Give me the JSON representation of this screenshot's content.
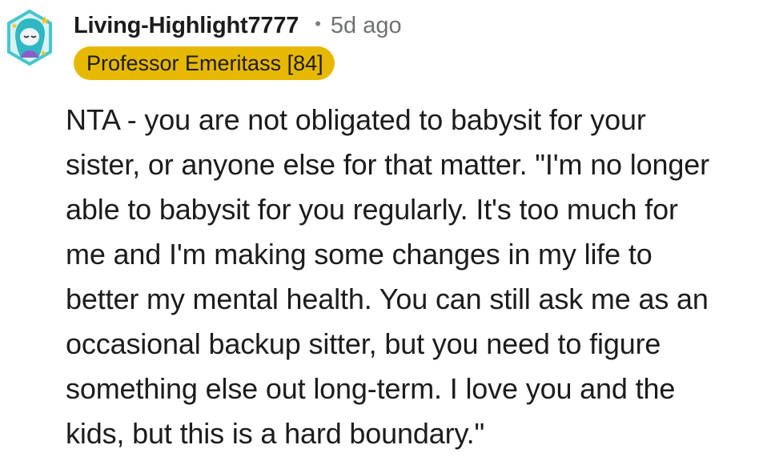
{
  "comment": {
    "username": "Living-Highlight7777",
    "separator": "•",
    "age": "5d ago",
    "flair": "Professor Emeritass [84]",
    "flair_color": "#e6b800",
    "avatar_icon": "snoo-avatar-icon",
    "body": "NTA - you are not obligated to babysit for your\nsister, or anyone else for that matter. \"I'm no longer\nable to babysit for you regularly. It's too much for\nme and I'm making some changes in my life to\nbetter my mental health. You can still ask me as an\noccasional backup sitter, but you need to figure\nsomething else out long-term. I love you and the\nkids, but this is a hard boundary.\""
  }
}
